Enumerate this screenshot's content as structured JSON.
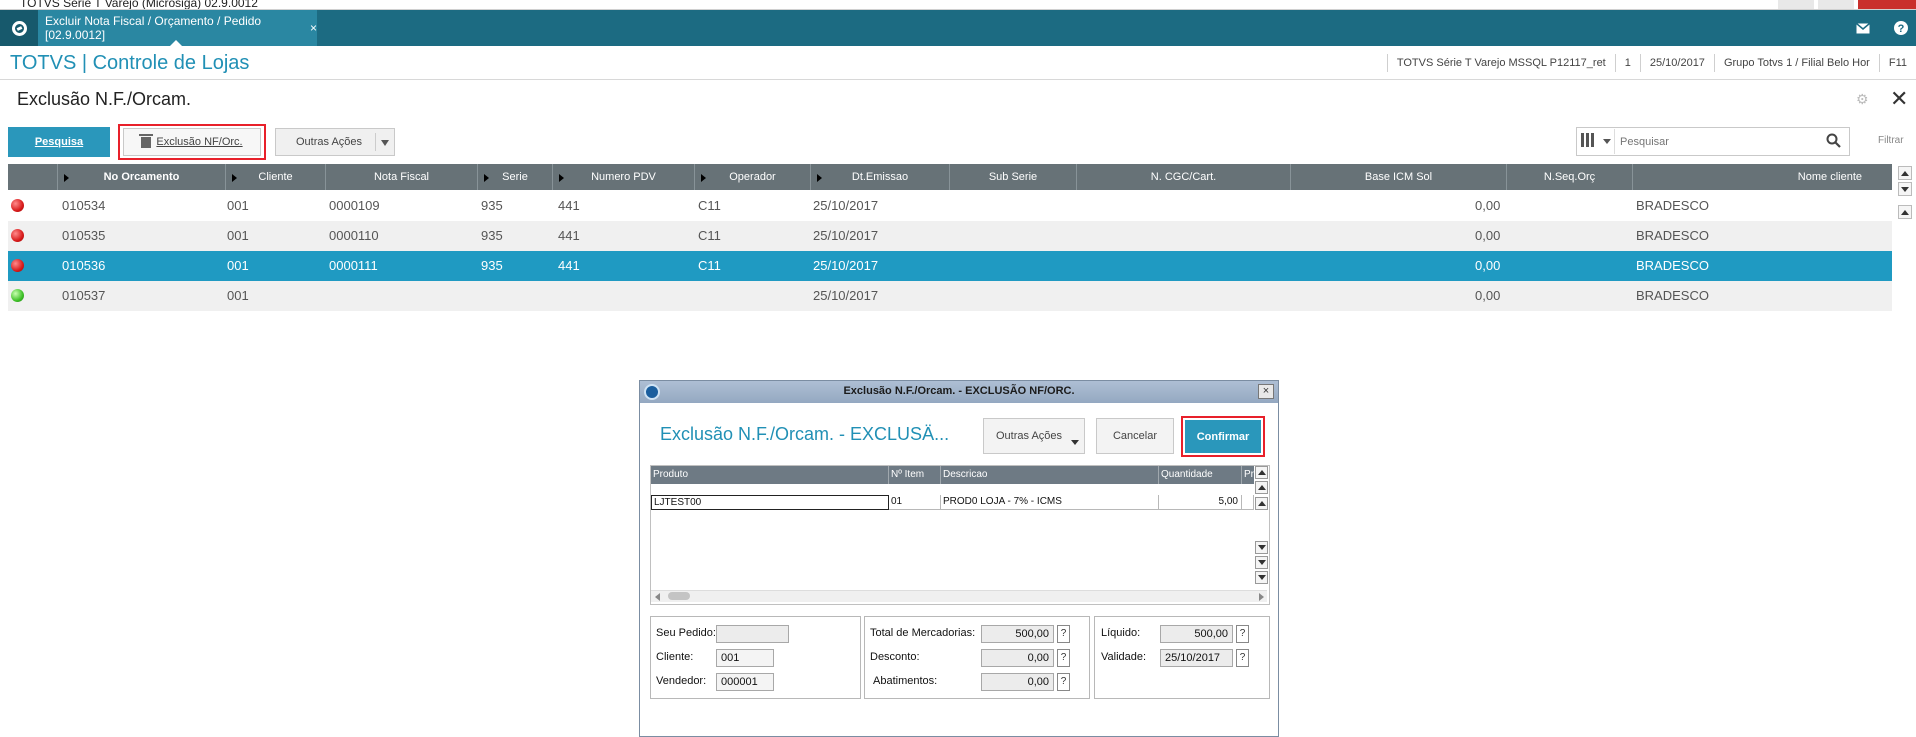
{
  "window": {
    "title": "TOTVS Série T Varejo (Microsiga) 02.9.0012"
  },
  "tabs": {
    "active_label": "Excluir Nota Fiscal / Orçamento / Pedido [02.9.0012]",
    "close_glyph": "×"
  },
  "header": {
    "app_title": "TOTVS | Controle de Lojas",
    "info": [
      "TOTVS Série T Varejo MSSQL P12117_ret",
      "1",
      "25/10/2017",
      "Grupo Totvs 1 / Filial Belo Hor",
      "F11"
    ]
  },
  "page": {
    "title": "Exclusão N.F./Orcam.",
    "close_glyph": "✕",
    "gear_glyph": "⚙"
  },
  "toolbar": {
    "pesquisa": "Pesquisa",
    "exclusao": "Exclusão NF/Orc.",
    "outras": "Outras Ações",
    "search_placeholder": "Pesquisar",
    "filtrar": "Filtrar"
  },
  "grid": {
    "columns": [
      "No Orcamento",
      "Cliente",
      "Nota Fiscal",
      "Serie",
      "Numero PDV",
      "Operador",
      "Dt.Emissao",
      "Sub Serie",
      "N. CGC/Cart.",
      "Base ICM Sol",
      "N.Seq.Orç",
      "Nome cliente"
    ],
    "rows": [
      {
        "status": "red",
        "orcamento": "010534",
        "cliente": "001",
        "nota": "0000109",
        "serie": "935",
        "pdv": "441",
        "operador": "C11",
        "emissao": "25/10/2017",
        "base_icm": "0,00",
        "nome": "BRADESCO"
      },
      {
        "status": "red",
        "orcamento": "010535",
        "cliente": "001",
        "nota": "0000110",
        "serie": "935",
        "pdv": "441",
        "operador": "C11",
        "emissao": "25/10/2017",
        "base_icm": "0,00",
        "nome": "BRADESCO"
      },
      {
        "status": "red",
        "orcamento": "010536",
        "cliente": "001",
        "nota": "0000111",
        "serie": "935",
        "pdv": "441",
        "operador": "C11",
        "emissao": "25/10/2017",
        "base_icm": "0,00",
        "nome": "BRADESCO"
      },
      {
        "status": "green",
        "orcamento": "010537",
        "cliente": "001",
        "nota": "",
        "serie": "",
        "pdv": "",
        "operador": "",
        "emissao": "25/10/2017",
        "base_icm": "0,00",
        "nome": "BRADESCO"
      }
    ],
    "selected_row": 2
  },
  "dialog": {
    "title": "Exclusão N.F./Orcam. - EXCLUSÃO NF/ORC.",
    "heading": "Exclusão N.F./Orcam. - EXCLUSÄ...",
    "outras": "Outras Ações",
    "cancelar": "Cancelar",
    "confirmar": "Confirmar",
    "items_columns": [
      "Produto",
      "Nº Item",
      "Descricao",
      "Quantidade",
      "Pr"
    ],
    "items": [
      {
        "produto": "LJTEST00",
        "item": "01",
        "descricao": "PROD0 LOJA - 7% - ICMS",
        "quantidade": "5,00"
      }
    ],
    "fields": {
      "seu_pedido_label": "Seu Pedido:",
      "seu_pedido": "",
      "cliente_label": "Cliente:",
      "cliente": "001",
      "vendedor_label": "Vendedor:",
      "vendedor": "000001",
      "total_merc_label": "Total de Mercadorias:",
      "total_merc": "500,00",
      "desconto_label": "Desconto:",
      "desconto": "0,00",
      "abatimentos_label": "Abatimentos:",
      "abatimentos": "0,00",
      "liquido_label": "Líquido:",
      "liquido": "500,00",
      "validade_label": "Validade:",
      "validade": "25/10/2017",
      "help_glyph": "?"
    }
  }
}
